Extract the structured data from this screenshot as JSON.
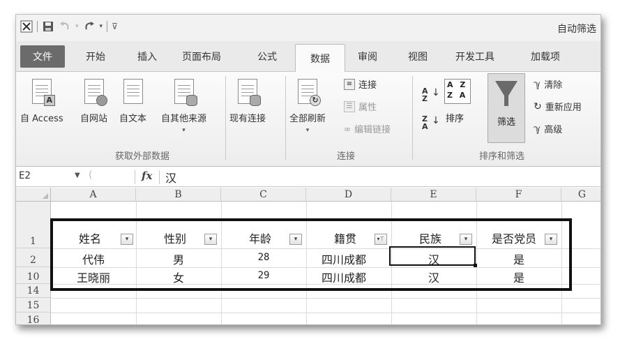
{
  "window": {
    "title": "自动筛选"
  },
  "qat": {
    "excel_icon": "excel-icon",
    "save_icon": "save-icon",
    "undo_icon": "undo-icon",
    "redo_icon": "redo-icon",
    "customize_icon": "customize-icon"
  },
  "tabs": [
    {
      "label": "文件",
      "kind": "file"
    },
    {
      "label": "开始"
    },
    {
      "label": "插入"
    },
    {
      "label": "页面布局"
    },
    {
      "label": "公式"
    },
    {
      "label": "数据",
      "active": true
    },
    {
      "label": "审阅"
    },
    {
      "label": "视图"
    },
    {
      "label": "开发工具"
    },
    {
      "label": "加载项"
    }
  ],
  "ribbon": {
    "get_external": {
      "label": "获取外部数据",
      "buttons": [
        {
          "label": "自 Access",
          "badge": "A"
        },
        {
          "label": "自网站",
          "badge": ""
        },
        {
          "label": "自文本",
          "badge": ""
        },
        {
          "label": "自其他来源",
          "badge": "",
          "caret": "▾"
        }
      ]
    },
    "existing": {
      "label": "现有连接"
    },
    "connections": {
      "label": "连接",
      "refresh_all": "全部刷新",
      "refresh_caret": "▾",
      "connections_btn": "连接",
      "properties_btn": "属性",
      "edit_links_btn": "编辑链接"
    },
    "sort_filter": {
      "label": "排序和筛选",
      "sort_asc_top": "A",
      "sort_asc_bottom": "Z",
      "sort_desc_top": "Z",
      "sort_desc_bottom": "A",
      "sortbox_row1": "A Z",
      "sortbox_row2": "Z A",
      "sort": "排序",
      "filter": "筛选",
      "clear": "清除",
      "reapply": "重新应用",
      "advanced": "高级"
    }
  },
  "formula_bar": {
    "name_box": "E2",
    "fx": "fx",
    "value": "汉"
  },
  "sheet": {
    "columns": [
      "A",
      "B",
      "C",
      "D",
      "E",
      "F",
      "G"
    ],
    "row_numbers": [
      "1",
      "2",
      "10",
      "14",
      "15",
      "16"
    ],
    "header": [
      "姓名",
      "性别",
      "年龄",
      "籍贯",
      "民族",
      "是否党员"
    ],
    "rows": [
      [
        "代伟",
        "男",
        "28",
        "四川成都",
        "汉",
        "是"
      ],
      [
        "王晓丽",
        "女",
        "29",
        "四川成都",
        "汉",
        "是"
      ]
    ],
    "filter_arrow": "▾",
    "filtered_arrow": "▾⊤",
    "active_cell": "E2"
  }
}
